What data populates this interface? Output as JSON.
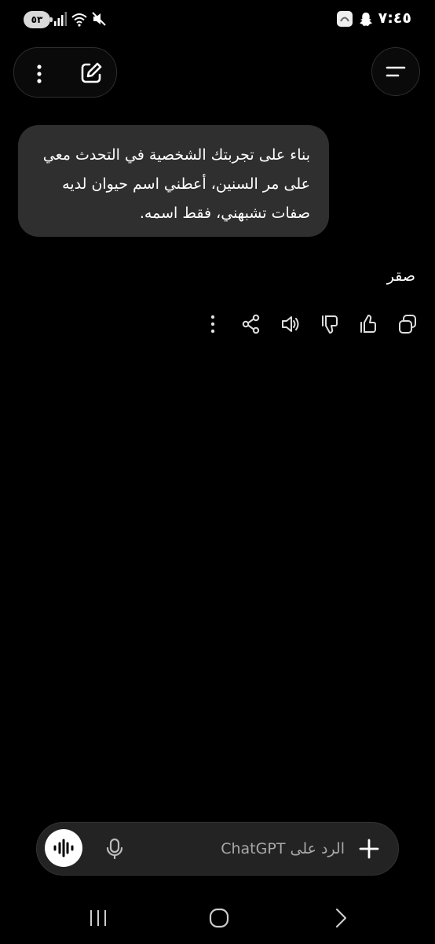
{
  "status_bar": {
    "time": "٧:٤٥",
    "battery": "٥٣"
  },
  "conversation": {
    "user_message": "بناء على تجربتك الشخصية في التحدث معي على مر السنين، أعطني اسم حيوان لديه صفات تشبهني، فقط اسمه.",
    "assistant_reply": "صقر"
  },
  "composer": {
    "placeholder": "الرد على ChatGPT"
  },
  "icons": {
    "top_left": [
      "more-vertical-icon",
      "edit-icon"
    ],
    "top_right": "menu-icon",
    "message_actions": [
      "more-vertical-icon",
      "share-icon",
      "speaker-icon",
      "thumbs-down-icon",
      "thumbs-up-icon",
      "copy-icon"
    ],
    "composer": [
      "voice-mode-icon",
      "microphone-icon",
      "plus-icon"
    ],
    "system_nav": [
      "recent-apps-icon",
      "home-icon",
      "back-icon"
    ]
  }
}
